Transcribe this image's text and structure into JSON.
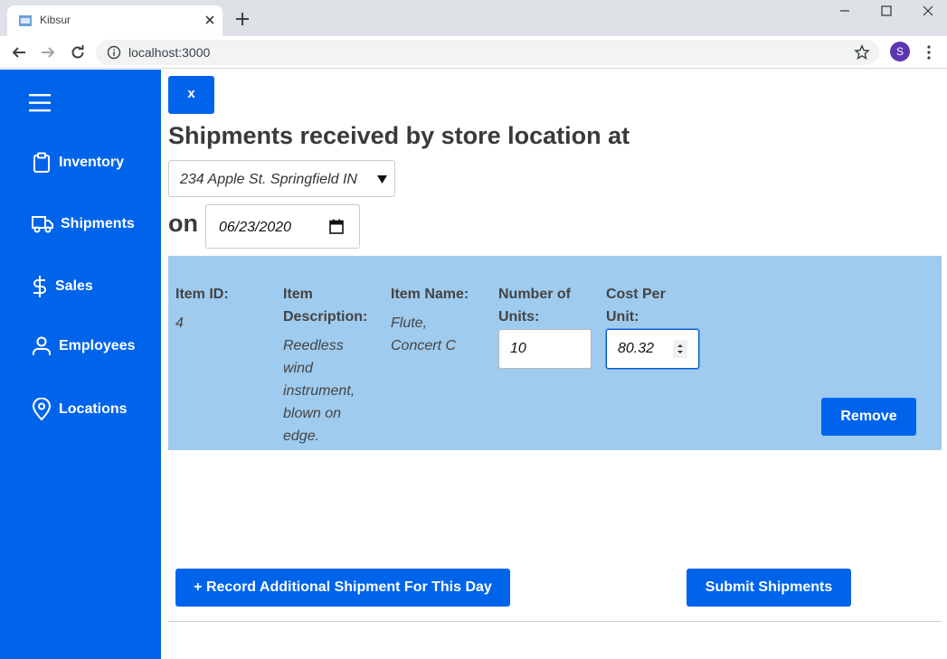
{
  "browser": {
    "tab_title": "Kibsur",
    "url": "localhost:3000",
    "profile_initial": "S"
  },
  "sidebar": {
    "items": [
      {
        "label": "Inventory",
        "icon": "clipboard-icon"
      },
      {
        "label": "Shipments",
        "icon": "truck-icon"
      },
      {
        "label": "Sales",
        "icon": "dollar-icon"
      },
      {
        "label": "Employees",
        "icon": "user-icon"
      },
      {
        "label": "Locations",
        "icon": "map-pin-icon"
      }
    ]
  },
  "main": {
    "close_label": "x",
    "heading": "Shipments received by store location at",
    "location_value": "234 Apple St. Springfield IN",
    "on_label": "on",
    "date_value": "06/23/2020",
    "shipment": {
      "item_id_header": "Item ID:",
      "item_id_value": "4",
      "desc_header_1": "Item",
      "desc_header_2": "Description:",
      "desc_lines": [
        "Reedless",
        "wind",
        "instrument,",
        "blown on",
        "edge."
      ],
      "name_header": "Item Name:",
      "name_lines": [
        "Flute,",
        "Concert C"
      ],
      "units_header_1": "Number of",
      "units_header_2": "Units:",
      "units_value": "10",
      "cost_header_1": "Cost Per",
      "cost_header_2": "Unit:",
      "cost_value": "80.32",
      "remove_label": "Remove"
    },
    "record_label": "+ Record Additional Shipment For This Day",
    "submit_label": "Submit Shipments"
  },
  "colors": {
    "primary": "#0064eb",
    "panel": "#9fcbee",
    "profile": "#5e35b1"
  }
}
